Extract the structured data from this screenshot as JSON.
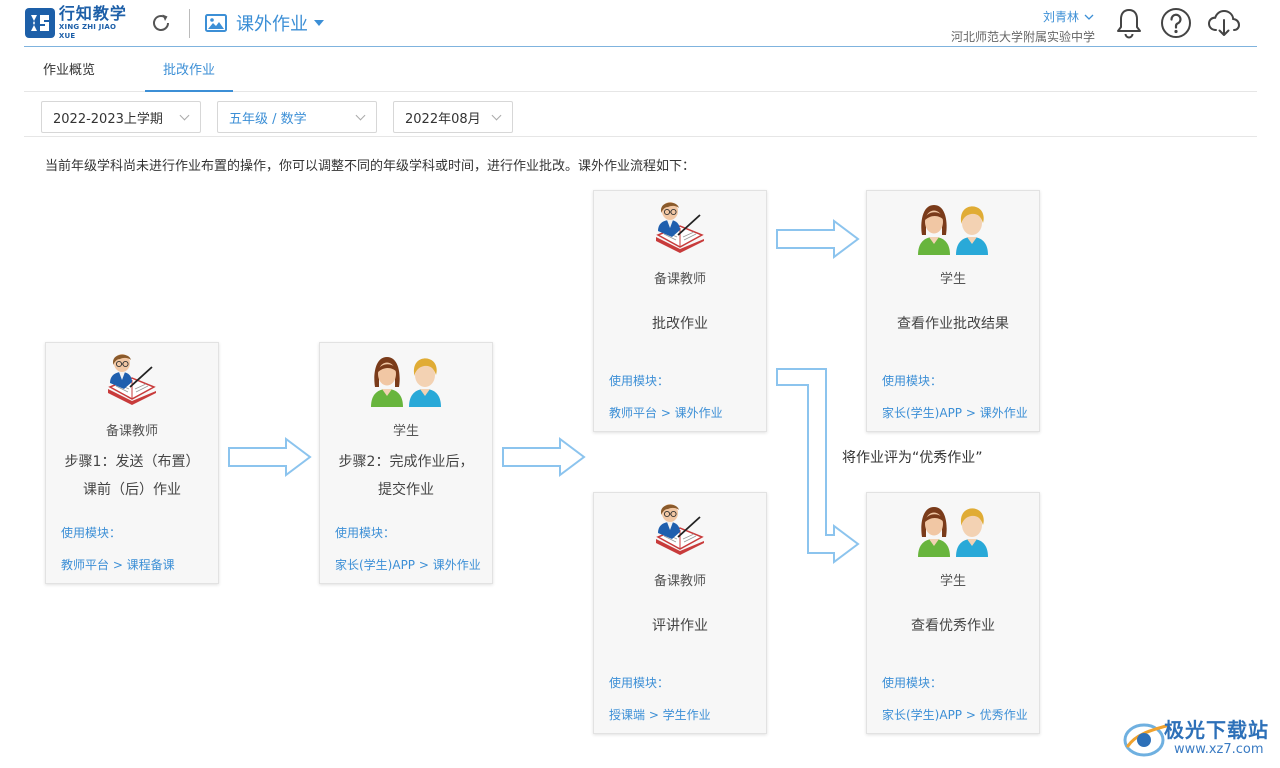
{
  "header": {
    "logo_cn": "行知教学",
    "logo_en": "XING ZHI JIAO XUE",
    "module_label": "课外作业",
    "user_name": "刘青林",
    "school": "河北师范大学附属实验中学"
  },
  "tabs": [
    {
      "label": "作业概览"
    },
    {
      "label": "批改作业"
    }
  ],
  "filters": {
    "term": "2022-2023上学期",
    "grade_subject": "五年级 / 数学",
    "month": "2022年08月"
  },
  "notice": "当前年级学科尚未进行作业布置的操作，你可以调整不同的年级学科或时间，进行作业批改。课外作业流程如下：",
  "module_label": "使用模块：",
  "cards": [
    {
      "role": "备课教师",
      "title_1": "步骤1：发送（布置）",
      "title_2": "课前（后）作业",
      "link": "教师平台 > 课程备课"
    },
    {
      "role": "学生",
      "title_1": "步骤2：完成作业后，",
      "title_2": "提交作业",
      "link": "家长(学生)APP > 课外作业"
    },
    {
      "role": "备课教师",
      "title_1": "批改作业",
      "link": "教师平台 > 课外作业"
    },
    {
      "role": "学生",
      "title_1": "查看作业批改结果",
      "link": "家长(学生)APP >  课外作业"
    },
    {
      "role": "备课教师",
      "title_1": "评讲作业",
      "link": "授课端 > 学生作业"
    },
    {
      "role": "学生",
      "title_1": "查看优秀作业",
      "link": "家长(学生)APP > 优秀作业"
    }
  ],
  "flow_label": "将作业评为“优秀作业”",
  "watermark": {
    "text": "极光下载站",
    "url": "www.xz7.com"
  },
  "colors": {
    "accent": "#3c8fd6",
    "brand": "#1d5fa8",
    "arrow": "#8cc4ee"
  }
}
